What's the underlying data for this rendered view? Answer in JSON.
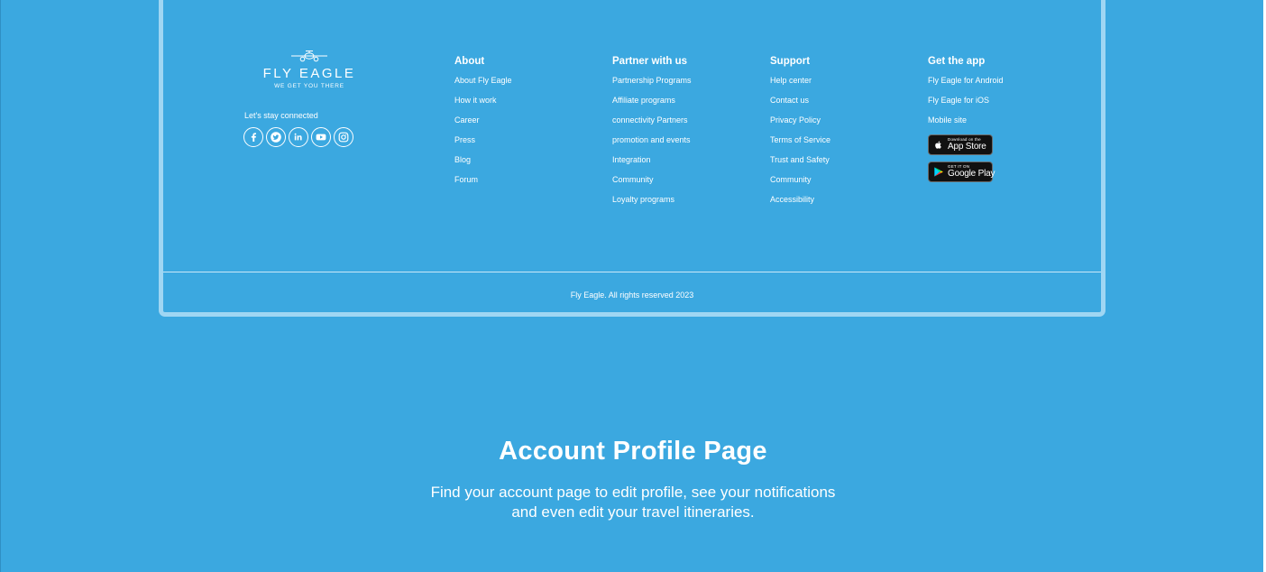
{
  "brand": {
    "name": "FLY EAGLE",
    "tagline": "WE GET YOU THERE",
    "connect_label": "Let's stay connected",
    "socials": [
      "facebook-icon",
      "twitter-icon",
      "linkedin-icon",
      "youtube-icon",
      "instagram-icon"
    ]
  },
  "columns": [
    {
      "title": "About",
      "items": [
        "About Fly Eagle",
        "How it work",
        "Career",
        "Press",
        "Blog",
        "Forum"
      ]
    },
    {
      "title": "Partner with us",
      "items": [
        "Partnership Programs",
        "Affiliate programs",
        "connectivity Partners",
        "promotion and events",
        "Integration",
        "Community",
        "Loyalty programs"
      ]
    },
    {
      "title": "Support",
      "items": [
        "Help center",
        "Contact us",
        "Privacy Policy",
        "Terms of Service",
        "Trust and Safety",
        "Community",
        "Accessibility"
      ]
    },
    {
      "title": "Get the app",
      "items": [
        "Fly Eagle for Android",
        "Fly Eagle for iOS",
        "Mobile site"
      ]
    }
  ],
  "stores": {
    "apple": {
      "small": "Download on the",
      "big": "App Store"
    },
    "google": {
      "small": "GET IT ON",
      "big": "Google Play"
    }
  },
  "copyright": "Fly Eagle. All rights reserved 2023",
  "hero": {
    "title": "Account Profile Page",
    "subtitle_line1": "Find your account page to edit profile, see your notifications",
    "subtitle_line2": "and even edit your travel itineraries."
  },
  "colors": {
    "background": "#3ba8e0",
    "card_border": "#9fd6f3",
    "text": "#ffffff",
    "store_button": "#111111"
  }
}
